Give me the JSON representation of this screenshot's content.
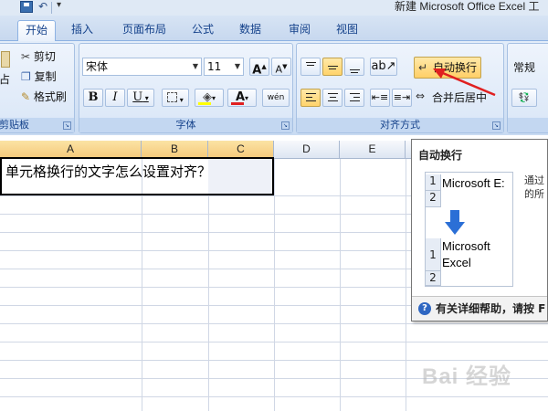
{
  "window": {
    "title": "新建 Microsoft Office Excel 工"
  },
  "tabs": [
    "开始",
    "插入",
    "页面布局",
    "公式",
    "数据",
    "审阅",
    "视图"
  ],
  "clipboard": {
    "cut": "剪切",
    "copy": "复制",
    "format_painter": "格式刷",
    "label": "剪贴板",
    "paste_fragment": "占"
  },
  "font": {
    "name": "宋体",
    "size": "11",
    "label": "字体",
    "bold": "B",
    "italic": "I",
    "underline": "U",
    "grow": "A",
    "shrink": "A",
    "color_letter": "A",
    "wen": "wén"
  },
  "alignment": {
    "wrap_text": "自动换行",
    "merge_center": "合并后居中",
    "label": "对齐方式"
  },
  "number": {
    "format": "常规"
  },
  "sheet": {
    "columns": [
      "A",
      "B",
      "C",
      "D",
      "E"
    ],
    "cell_a1": "单元格换行的文字怎么设置对齐？"
  },
  "tooltip": {
    "title": "自动换行",
    "before_row1": "1",
    "before_row2": "2",
    "before_text": "Microsoft E:",
    "after_row1": "1",
    "after_row2": "2",
    "after_line1": "Microsoft",
    "after_line2": "Excel",
    "desc_line1": "通过",
    "desc_line2": "的所",
    "help": "有关详细帮助，请按 F"
  },
  "watermark": "Bai 经验",
  "colors": {
    "accent": "#15428b",
    "wrap_highlight": "#ffd36b",
    "arrow": "#e02020"
  }
}
